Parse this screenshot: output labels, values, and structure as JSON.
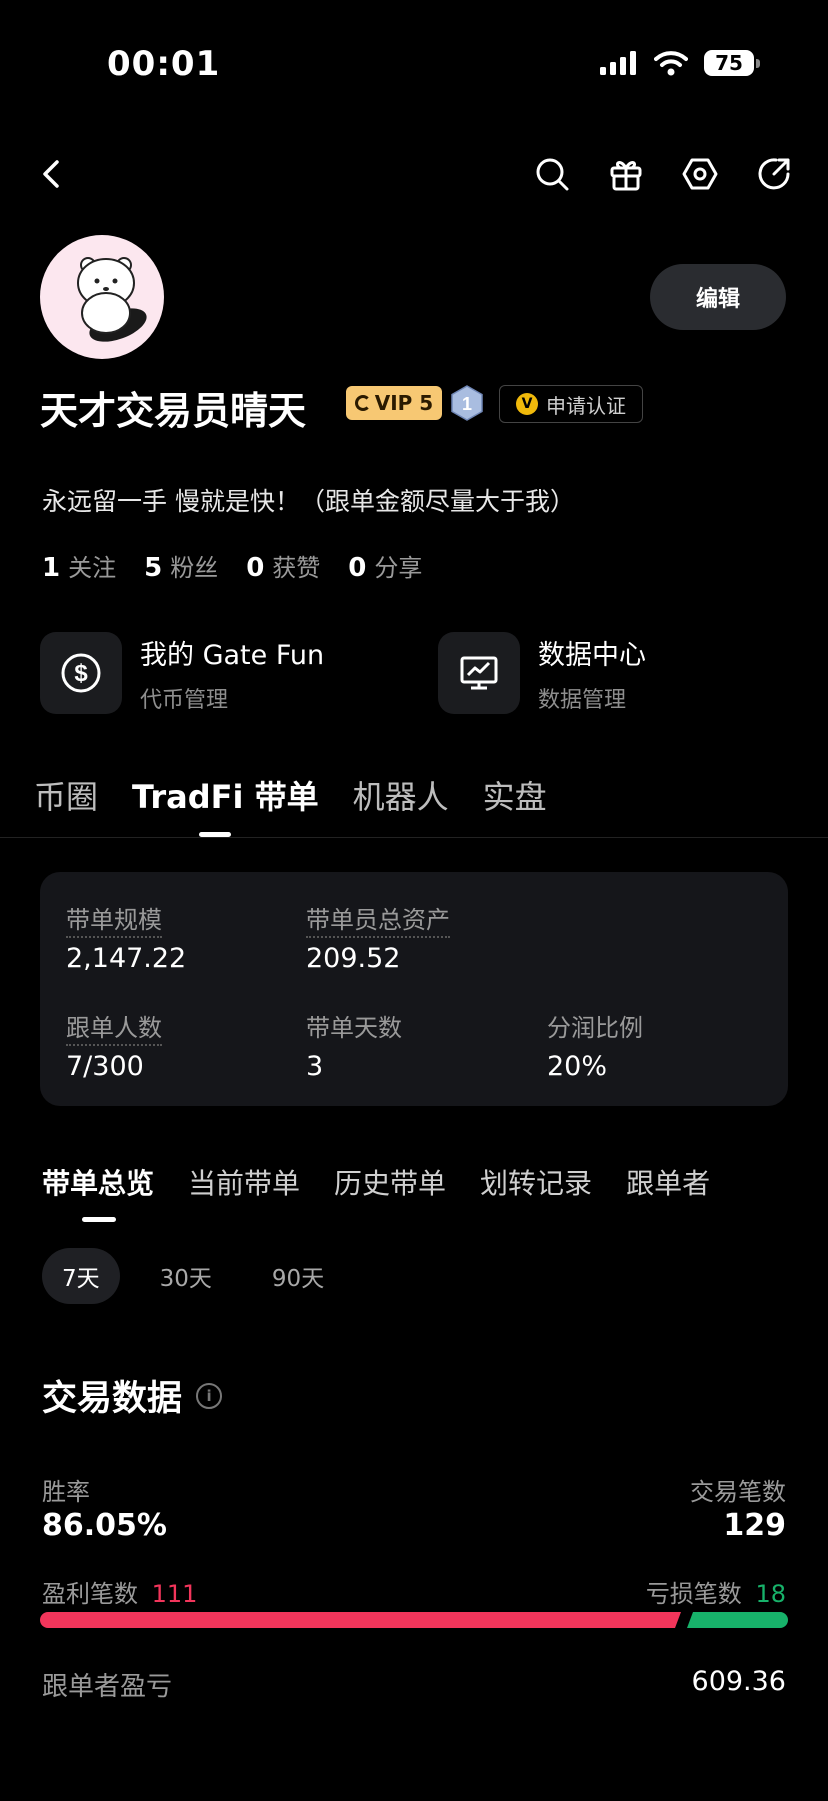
{
  "status_bar": {
    "time": "00:01",
    "battery": "75"
  },
  "header": {
    "icons": [
      "back-icon",
      "search-icon",
      "gift-icon",
      "settings-icon",
      "share-icon"
    ]
  },
  "profile": {
    "name": "天才交易员晴天",
    "vip": "VIP 5",
    "level": "1",
    "verify_label": "申请认证",
    "verify_mark": "V",
    "edit_label": "编辑",
    "bio": "永远留一手 慢就是快！（跟单金额尽量大于我）",
    "stats": [
      {
        "value": "1",
        "label": "关注"
      },
      {
        "value": "5",
        "label": "粉丝"
      },
      {
        "value": "0",
        "label": "获赞"
      },
      {
        "value": "0",
        "label": "分享"
      }
    ]
  },
  "features": [
    {
      "title": "我的 Gate Fun",
      "sub": "代币管理",
      "icon": "dollar-coin-icon"
    },
    {
      "title": "数据中心",
      "sub": "数据管理",
      "icon": "chart-monitor-icon"
    }
  ],
  "main_tabs": [
    {
      "label": "币圈",
      "active": false
    },
    {
      "label": "TradFi 带单",
      "active": true
    },
    {
      "label": "机器人",
      "active": false
    },
    {
      "label": "实盘",
      "active": false
    }
  ],
  "summary": {
    "scale_label": "带单规模",
    "scale_value": "2,147.22",
    "assets_label": "带单员总资产",
    "assets_value": "209.52",
    "followers_label": "跟单人数",
    "followers_value": "7/300",
    "days_label": "带单天数",
    "days_value": "3",
    "share_label": "分润比例",
    "share_value": "20%"
  },
  "sub_tabs": [
    {
      "label": "带单总览",
      "active": true
    },
    {
      "label": "当前带单",
      "active": false
    },
    {
      "label": "历史带单",
      "active": false
    },
    {
      "label": "划转记录",
      "active": false
    },
    {
      "label": "跟单者",
      "active": false
    }
  ],
  "ranges": [
    {
      "label": "7天",
      "active": true
    },
    {
      "label": "30天",
      "active": false
    },
    {
      "label": "90天",
      "active": false
    }
  ],
  "trade_data": {
    "title": "交易数据",
    "info_mark": "i",
    "win_rate_label": "胜率",
    "win_rate_value": "86.05%",
    "trade_count_label": "交易笔数",
    "trade_count_value": "129",
    "profit_label": "盈利笔数",
    "profit_value": "111",
    "loss_label": "亏损笔数",
    "loss_value": "18",
    "profit_fraction": 0.8605,
    "follower_pnl_label": "跟单者盈亏",
    "follower_pnl_value": "609.36"
  },
  "colors": {
    "accent_red": "#f2355b",
    "accent_green": "#17b26a",
    "vip_gold": "#f7c873"
  }
}
